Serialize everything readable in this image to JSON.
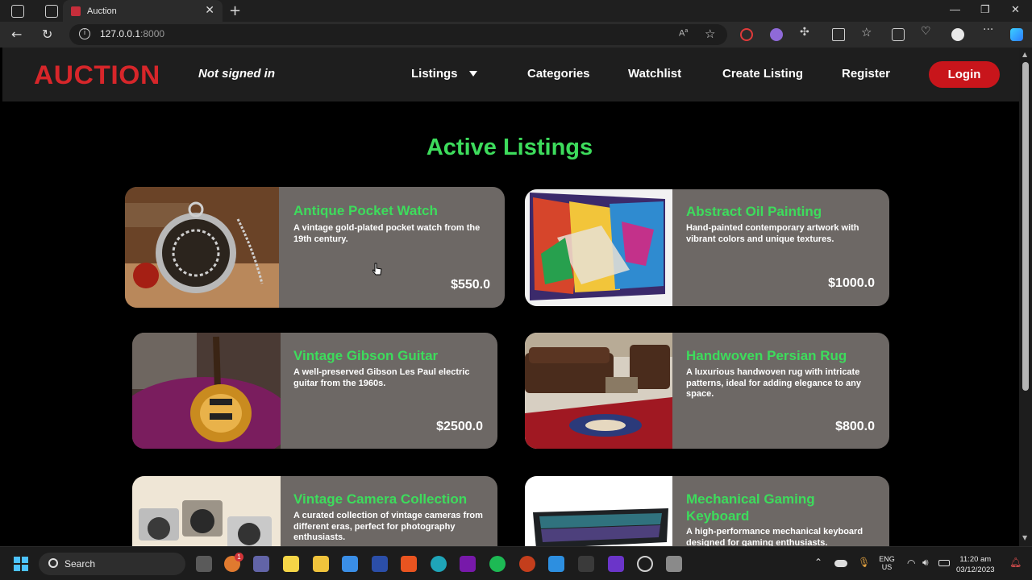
{
  "browser": {
    "tab_title": "Auction",
    "address_host": "127.0.0.1",
    "address_port": ":8000"
  },
  "site": {
    "logo": "AUCTION",
    "auth_status": "Not signed in",
    "nav": {
      "listings": "Listings",
      "categories": "Categories",
      "watchlist": "Watchlist",
      "create_listing": "Create Listing",
      "register": "Register",
      "login": "Login"
    },
    "heading": "Active Listings"
  },
  "listings": [
    {
      "title": "Antique Pocket Watch",
      "description": "A vintage gold-plated pocket watch from the 19th century.",
      "price": "$550.0",
      "image_icon": "pocket-watch-photo"
    },
    {
      "title": "Abstract Oil Painting",
      "description": "Hand-painted contemporary artwork with vibrant colors and unique textures.",
      "price": "$1000.0",
      "image_icon": "abstract-painting-photo"
    },
    {
      "title": "Vintage Gibson Guitar",
      "description": "A well-preserved Gibson Les Paul electric guitar from the 1960s.",
      "price": "$2500.0",
      "image_icon": "guitar-photo"
    },
    {
      "title": "Handwoven Persian Rug",
      "description": "A luxurious handwoven rug with intricate patterns, ideal for adding elegance to any space.",
      "price": "$800.0",
      "image_icon": "persian-rug-photo"
    },
    {
      "title": "Vintage Camera Collection",
      "description": "A curated collection of vintage cameras from different eras, perfect for photography enthusiasts.",
      "price": "",
      "image_icon": "vintage-cameras-photo"
    },
    {
      "title": "Mechanical Gaming Keyboard",
      "description": "A high-performance mechanical keyboard designed for gaming enthusiasts.",
      "price": "",
      "image_icon": "gaming-keyboard-photo"
    }
  ],
  "taskbar": {
    "search_placeholder": "Search",
    "language_line1": "ENG",
    "language_line2": "US",
    "time": "11:20 am",
    "date": "03/12/2023",
    "badge_count": "1"
  },
  "colors": {
    "accent_green": "#3ddc5c",
    "brand_red": "#d7262a",
    "card_bg": "#6d6865",
    "login_red": "#c8151b"
  }
}
